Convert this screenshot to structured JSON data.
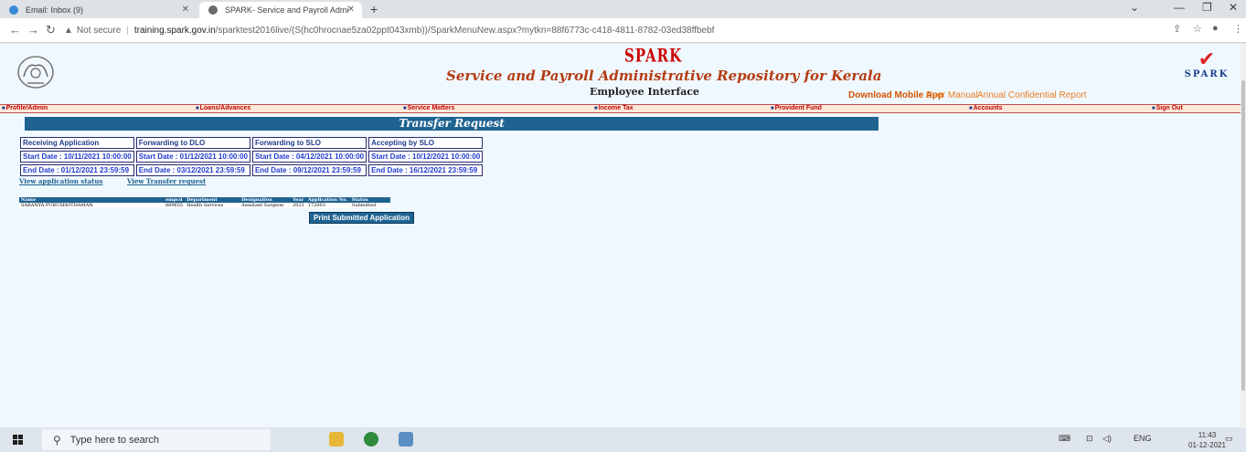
{
  "browser": {
    "tabs": [
      {
        "label": "Email: Inbox (9)"
      },
      {
        "label": "SPARK- Service and Payroll Admi"
      }
    ],
    "new_tab": "+",
    "security_label": "Not secure",
    "url_host": "training.spark.gov.in",
    "url_path": "/sparktest2016live/(S(hc0hrocnae5za02ppt043xmb))/SparkMenuNew.aspx?mytkn=88f6773c-c418-4811-8782-03ed38ffbebf"
  },
  "header": {
    "brand": "SPARK",
    "title": "Service and Payroll Administrative Repository for Kerala",
    "subtitle": "Employee Interface",
    "logo_word": "SPARK",
    "links": {
      "download_app": "Download Mobile App",
      "user_manual": "User Manual",
      "acr": "Annual Confidential Report"
    }
  },
  "menu": [
    "Profile/Admin",
    "Loans/Advances",
    "Service Matters",
    "Income Tax",
    "Provident Fund",
    "Accounts",
    "Sign Out"
  ],
  "section_title": "Transfer Request",
  "schedule": [
    {
      "heading": "Receiving Application",
      "start": "Start Date : 10/11/2021 10:00:00",
      "end": "End Date : 01/12/2021 23:59:59"
    },
    {
      "heading": "Forwarding to DLO",
      "start": "Start Date : 01/12/2021 10:00:00",
      "end": "End Date : 03/12/2021 23:59:59"
    },
    {
      "heading": "Forwarding to SLO",
      "start": "Start Date : 04/12/2021 10:00:00",
      "end": "End Date : 09/12/2021 23:59:59"
    },
    {
      "heading": "Accepting by SLO",
      "start": "Start Date : 10/12/2021 10:00:00",
      "end": "End Date : 16/12/2021 23:59:59"
    }
  ],
  "links": {
    "view_status": "View application status",
    "view_request": "View Transfer request"
  },
  "applications": {
    "columns": [
      "Name",
      "empcd",
      "Department",
      "Designation",
      "Year",
      "Application No.",
      "Status"
    ],
    "rows": [
      [
        "SARANYA PURUSHOTHAMAN",
        "889655",
        "Health Services",
        "Assistant Surgeon",
        "2021",
        "172003",
        "Submitted"
      ]
    ]
  },
  "print_button": "Print Submitted Application",
  "taskbar": {
    "search_placeholder": "Type here to search",
    "language": "ENG",
    "time": "11:43",
    "date": "01-12-2021"
  }
}
